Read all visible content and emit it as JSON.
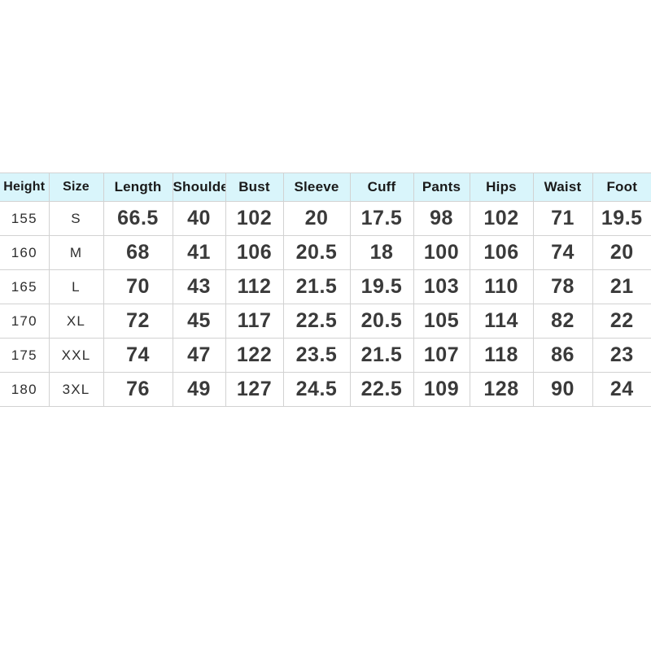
{
  "table": {
    "columns": [
      {
        "key": "height",
        "label": "Height"
      },
      {
        "key": "size",
        "label": "Size"
      },
      {
        "key": "length",
        "label": "Length"
      },
      {
        "key": "shoulder",
        "label": "Shoulder"
      },
      {
        "key": "bust",
        "label": "Bust"
      },
      {
        "key": "sleeve",
        "label": "Sleeve"
      },
      {
        "key": "cuff",
        "label": "Cuff"
      },
      {
        "key": "pants",
        "label": "Pants"
      },
      {
        "key": "hips",
        "label": "Hips"
      },
      {
        "key": "waist",
        "label": "Waist"
      },
      {
        "key": "foot",
        "label": "Foot"
      }
    ],
    "rows": [
      {
        "height": "155",
        "size": "S",
        "length": "66.5",
        "shoulder": "40",
        "bust": "102",
        "sleeve": "20",
        "cuff": "17.5",
        "pants": "98",
        "hips": "102",
        "waist": "71",
        "foot": "19.5"
      },
      {
        "height": "160",
        "size": "M",
        "length": "68",
        "shoulder": "41",
        "bust": "106",
        "sleeve": "20.5",
        "cuff": "18",
        "pants": "100",
        "hips": "106",
        "waist": "74",
        "foot": "20"
      },
      {
        "height": "165",
        "size": "L",
        "length": "70",
        "shoulder": "43",
        "bust": "112",
        "sleeve": "21.5",
        "cuff": "19.5",
        "pants": "103",
        "hips": "110",
        "waist": "78",
        "foot": "21"
      },
      {
        "height": "170",
        "size": "XL",
        "length": "72",
        "shoulder": "45",
        "bust": "117",
        "sleeve": "22.5",
        "cuff": "20.5",
        "pants": "105",
        "hips": "114",
        "waist": "82",
        "foot": "22"
      },
      {
        "height": "175",
        "size": "XXL",
        "length": "74",
        "shoulder": "47",
        "bust": "122",
        "sleeve": "23.5",
        "cuff": "21.5",
        "pants": "107",
        "hips": "118",
        "waist": "86",
        "foot": "23"
      },
      {
        "height": "180",
        "size": "3XL",
        "length": "76",
        "shoulder": "49",
        "bust": "127",
        "sleeve": "24.5",
        "cuff": "22.5",
        "pants": "109",
        "hips": "128",
        "waist": "90",
        "foot": "24"
      }
    ]
  },
  "colors": {
    "header_background": "#d9f5fb",
    "page_background": "#ffffff",
    "border": "#d2d2d2",
    "data_text": "#3a3a3a",
    "header_text": "#1a1a1a"
  }
}
